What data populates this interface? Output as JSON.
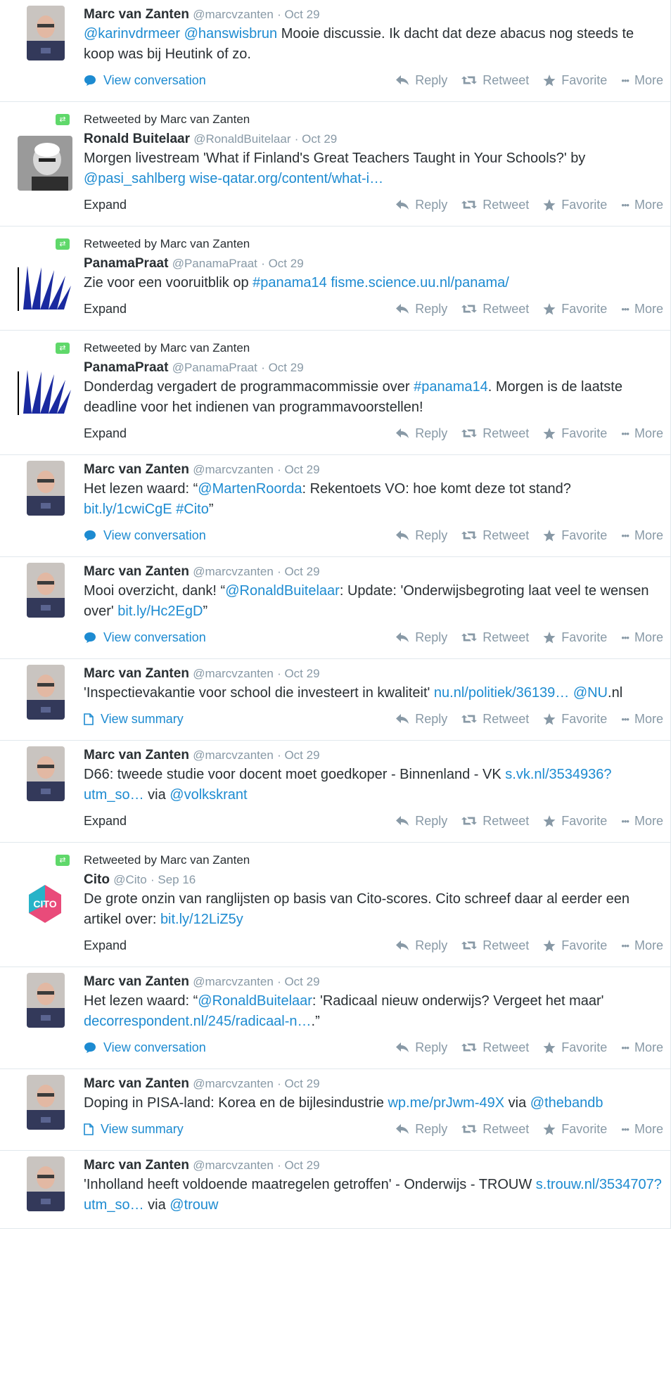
{
  "actions": {
    "reply": "Reply",
    "retweet": "Retweet",
    "favorite": "Favorite",
    "more": "More"
  },
  "tweets": [
    {
      "name": "Marc van Zanten",
      "handle": "@marcvzanten",
      "date": "· Oct 29",
      "segments": [
        {
          "t": "@karinvdrmeer",
          "link": true
        },
        {
          "t": " "
        },
        {
          "t": "@hanswisbrun",
          "link": true
        },
        {
          "t": " Mooie discussie. Ik dacht dat deze abacus nog steeds te koop was bij Heutink of zo."
        }
      ],
      "footer": "View conversation",
      "footer_type": "conversation"
    },
    {
      "context": "Retweeted by Marc van Zanten",
      "name": "Ronald Buitelaar",
      "handle": "@RonaldBuitelaar",
      "date": "· Oct 29",
      "segments": [
        {
          "t": "Morgen livestream 'What if Finland's Great Teachers Taught in Your Schools?' by "
        },
        {
          "t": "@pasi_sahlberg",
          "link": true
        },
        {
          "t": " "
        },
        {
          "t": "wise-qatar.org/content/what-i…",
          "link": true
        }
      ],
      "footer": "Expand",
      "footer_type": "expand"
    },
    {
      "context": "Retweeted by Marc van Zanten",
      "name": "PanamaPraat",
      "handle": "@PanamaPraat",
      "date": "· Oct 29",
      "segments": [
        {
          "t": "Zie voor een vooruitblik op "
        },
        {
          "t": "#panama14",
          "link": true
        },
        {
          "t": " "
        },
        {
          "t": "fisme.science.uu.nl/panama/",
          "link": true
        }
      ],
      "footer": "Expand",
      "footer_type": "expand"
    },
    {
      "context": "Retweeted by Marc van Zanten",
      "name": "PanamaPraat",
      "handle": "@PanamaPraat",
      "date": "· Oct 29",
      "segments": [
        {
          "t": "Donderdag vergadert de programmacommissie over "
        },
        {
          "t": "#panama14",
          "link": true
        },
        {
          "t": ". Morgen is de laatste deadline voor het indienen van programmavoorstellen!"
        }
      ],
      "footer": "Expand",
      "footer_type": "expand"
    },
    {
      "name": "Marc van Zanten",
      "handle": "@marcvzanten",
      "date": "· Oct 29",
      "segments": [
        {
          "t": "Het lezen waard: “"
        },
        {
          "t": "@MartenRoorda",
          "link": true
        },
        {
          "t": ": Rekentoets VO: hoe komt deze tot stand? "
        },
        {
          "t": "bit.ly/1cwiCgE",
          "link": true
        },
        {
          "t": " "
        },
        {
          "t": "#Cito",
          "link": true
        },
        {
          "t": "”"
        }
      ],
      "footer": "View conversation",
      "footer_type": "conversation"
    },
    {
      "name": "Marc van Zanten",
      "handle": "@marcvzanten",
      "date": "· Oct 29",
      "segments": [
        {
          "t": "Mooi overzicht, dank! “"
        },
        {
          "t": "@RonaldBuitelaar",
          "link": true
        },
        {
          "t": ": Update: 'Onderwijsbegroting laat veel te wensen over' "
        },
        {
          "t": "bit.ly/Hc2EgD",
          "link": true
        },
        {
          "t": "”"
        }
      ],
      "footer": "View conversation",
      "footer_type": "conversation"
    },
    {
      "name": "Marc van Zanten",
      "handle": "@marcvzanten",
      "date": "· Oct 29",
      "segments": [
        {
          "t": "'Inspectievakantie voor school die investeert in kwaliteit' "
        },
        {
          "t": "nu.nl/politiek/36139…",
          "link": true
        },
        {
          "t": " "
        },
        {
          "t": "@NU",
          "link": true
        },
        {
          "t": ".nl"
        }
      ],
      "footer": "View summary",
      "footer_type": "summary"
    },
    {
      "name": "Marc van Zanten",
      "handle": "@marcvzanten",
      "date": "· Oct 29",
      "segments": [
        {
          "t": "D66: tweede studie voor docent moet goedkoper - Binnenland - VK "
        },
        {
          "t": "s.vk.nl/3534936?utm_so…",
          "link": true
        },
        {
          "t": " via "
        },
        {
          "t": "@volkskrant",
          "link": true
        }
      ],
      "footer": "Expand",
      "footer_type": "expand"
    },
    {
      "context": "Retweeted by Marc van Zanten",
      "name": "Cito",
      "handle": "@Cito",
      "date": "· Sep 16",
      "segments": [
        {
          "t": "De grote onzin van ranglijsten op basis van Cito-scores. Cito schreef daar al eerder een artikel over: "
        },
        {
          "t": "bit.ly/12LiZ5y",
          "link": true
        }
      ],
      "footer": "Expand",
      "footer_type": "expand"
    },
    {
      "name": "Marc van Zanten",
      "handle": "@marcvzanten",
      "date": "· Oct 29",
      "segments": [
        {
          "t": "Het lezen waard: “"
        },
        {
          "t": "@RonaldBuitelaar",
          "link": true
        },
        {
          "t": ": 'Radicaal nieuw onderwijs? Vergeet het maar' "
        },
        {
          "t": "decorrespondent.nl/245/radicaal-n…",
          "link": true
        },
        {
          "t": ".”"
        }
      ],
      "footer": "View conversation",
      "footer_type": "conversation"
    },
    {
      "name": "Marc van Zanten",
      "handle": "@marcvzanten",
      "date": "· Oct 29",
      "segments": [
        {
          "t": "Doping in PISA-land: Korea en de bijlesindustrie "
        },
        {
          "t": "wp.me/prJwm-49X",
          "link": true
        },
        {
          "t": " via "
        },
        {
          "t": "@thebandb",
          "link": true
        }
      ],
      "footer": "View summary",
      "footer_type": "summary"
    },
    {
      "name": "Marc van Zanten",
      "handle": "@marcvzanten",
      "date": "· Oct 29",
      "segments": [
        {
          "t": "'Inholland heeft voldoende maatregelen getroffen' - Onderwijs - TROUW "
        },
        {
          "t": "s.trouw.nl/3534707?utm_so…",
          "link": true
        },
        {
          "t": " via "
        },
        {
          "t": "@trouw",
          "link": true
        }
      ],
      "footer": "",
      "footer_type": "none"
    }
  ],
  "colors": {
    "link": "#1d8bd1",
    "muted": "#8899a6",
    "text": "#292f33",
    "retweet_green": "#5fd86a"
  }
}
